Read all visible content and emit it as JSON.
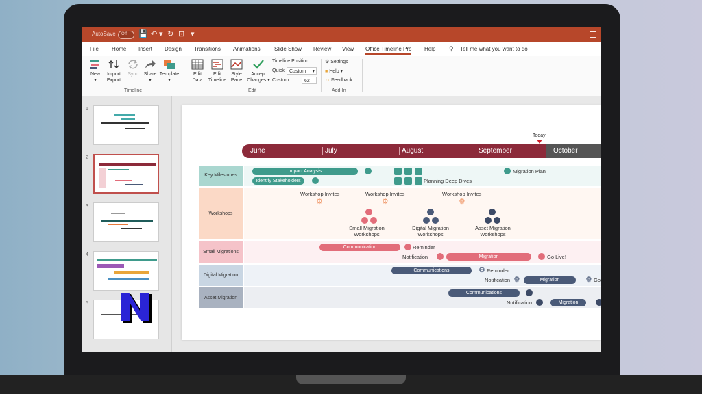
{
  "titlebar": {
    "autosave": "AutoSave",
    "toggle": "Off"
  },
  "menu": {
    "items": [
      "File",
      "Home",
      "Insert",
      "Design",
      "Transitions",
      "Animations",
      "Slide Show",
      "Review",
      "View",
      "Office Timeline Pro",
      "Help"
    ],
    "search_placeholder": "Tell me what you want to do"
  },
  "ribbon": {
    "new": "New",
    "import": "Import",
    "export": "Export",
    "sync": "Sync",
    "share": "Share",
    "template": "Template",
    "group_timeline": "Timeline",
    "edit_data": [
      "Edit",
      "Data"
    ],
    "edit_timeline": [
      "Edit",
      "Timeline"
    ],
    "style_pane": [
      "Style",
      "Pane"
    ],
    "accept": [
      "Accept",
      "Changes"
    ],
    "timeline_position": "Timeline Position",
    "quick": "Quick",
    "quick_value": "Custom",
    "custom": "Custom",
    "custom_value": "62",
    "group_edit": "Edit",
    "settings": "Settings",
    "help": "Help",
    "feedback": "Feedback",
    "group_addin": "Add-In",
    "accent_color": "#b7472a"
  },
  "thumbnails": [
    "1",
    "2",
    "3",
    "4",
    "5"
  ],
  "slide": {
    "today": "Today",
    "months": [
      "June",
      "July",
      "August",
      "September",
      "October"
    ],
    "band_color": "#8c2a3a",
    "swimlanes": {
      "key_milestones": "Key Milestones",
      "workshops": "Workshops",
      "small_migrations": "Small Migrations",
      "digital_migration": "Digital Migration",
      "asset_migration": "Asset Migration"
    },
    "key": {
      "impact_analysis": "Impact Analysis",
      "identify_stakeholders": "Identify Stakeholders",
      "migration_plan": "Migration Plan",
      "planning_deep_dives": "Planning Deep Dives",
      "color": "#3f9b8c"
    },
    "workshops": {
      "invites": "Workshop Invites",
      "small": [
        "Small Migration",
        "Workshops"
      ],
      "digital": [
        "Digital Migration",
        "Workshops"
      ],
      "asset": [
        "Asset Migration",
        "Workshops"
      ]
    },
    "small": {
      "communication": "Communication",
      "reminder": "Reminder",
      "notification": "Notification",
      "migration": "Migration",
      "go_live": "Go Live!",
      "color": "#e26d7a"
    },
    "digital": {
      "communications": "Communications",
      "reminder": "Reminder",
      "notification": "Notification",
      "migration": "Migration",
      "go_live": "Go",
      "color": "#4a5a78"
    },
    "asset": {
      "communications": "Communications",
      "notification": "Notification",
      "migration": "Migration"
    }
  }
}
